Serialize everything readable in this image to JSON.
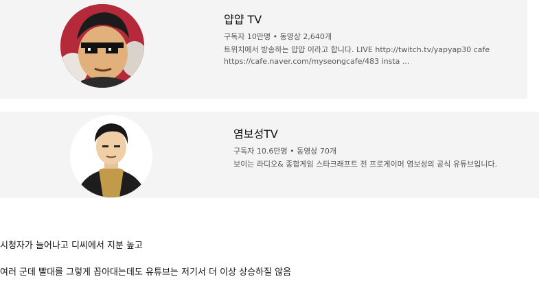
{
  "channels": [
    {
      "name": "얍얍 TV",
      "meta": "구독자 10만명 • 동영상 2,640개",
      "desc_line1": "트위치에서 방송하는 얍얍 이라고 합니다. LIVE http://twitch.tv/yapyap30 cafe",
      "desc_line2": "https://cafe.naver.com/myseongcafe/483 insta ...",
      "avatar_icon": "cartoon-face-sunglasses-avatar"
    },
    {
      "name": "염보성TV",
      "meta": "구독자 10.6만명 • 동영상 70개",
      "desc_line1": "보이는 라디오& 종합게임 스타크래프트 전 프로게이머 염보성의 공식 유튜브입니다.",
      "avatar_icon": "cartoon-man-jacket-avatar"
    }
  ],
  "post": {
    "line1": "시청자가 늘어나고 디씨에서 지분 높고",
    "line2": "여러 군데 빨대를 그렇게 꼽아대는데도 유튜브는 저기서 더 이상 상승하질 않음"
  },
  "colors": {
    "card_bg": "#f4f4f4",
    "meta_text": "#555555",
    "title_text": "#0f0f0f"
  }
}
